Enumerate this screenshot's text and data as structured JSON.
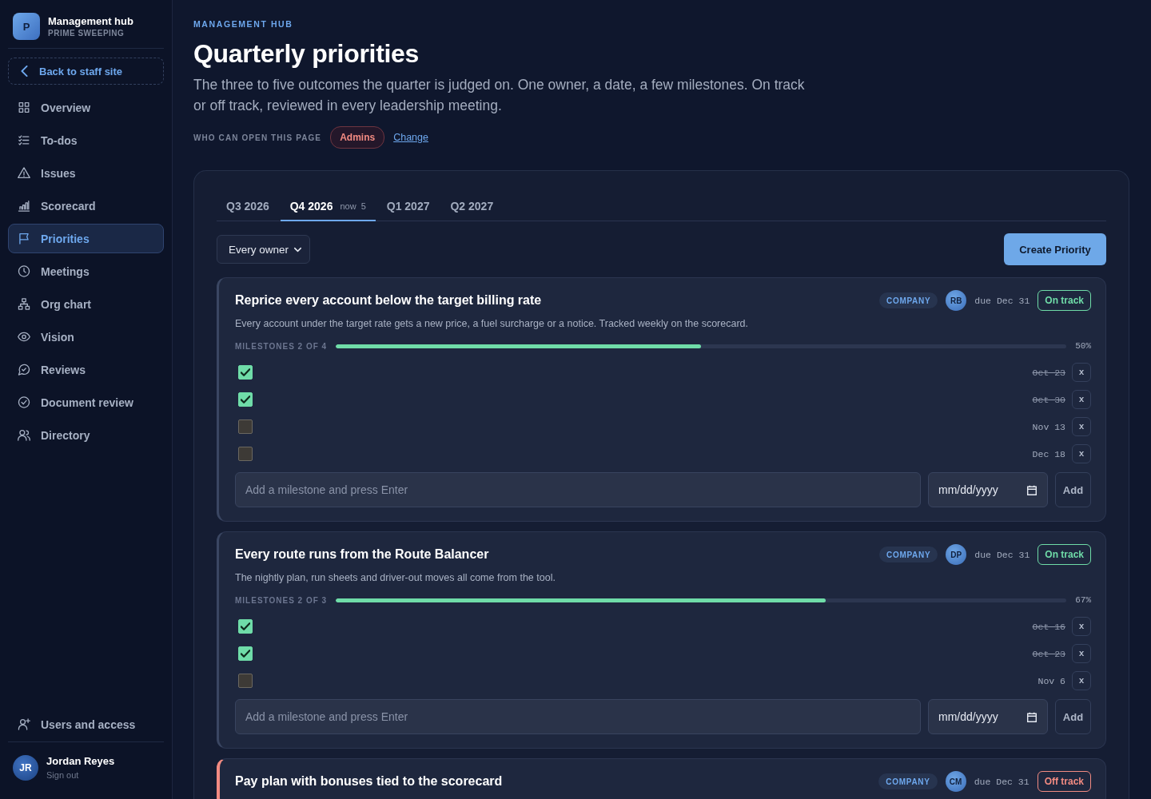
{
  "sidebar": {
    "brand": {
      "initial": "P",
      "title": "Management hub",
      "subtitle": "PRIME SWEEPING"
    },
    "back_link": "Back to staff site",
    "nav": [
      {
        "label": "Overview",
        "selected": false
      },
      {
        "label": "To-dos",
        "selected": false
      },
      {
        "label": "Issues",
        "selected": false
      },
      {
        "label": "Scorecard",
        "selected": false
      },
      {
        "label": "Priorities",
        "selected": true
      },
      {
        "label": "Meetings",
        "selected": false
      },
      {
        "label": "Org chart",
        "selected": false
      },
      {
        "label": "Vision",
        "selected": false
      },
      {
        "label": "Reviews",
        "selected": false
      },
      {
        "label": "Document review",
        "selected": false
      },
      {
        "label": "Directory",
        "selected": false
      }
    ],
    "footer_link": "Users and access",
    "user": {
      "initials": "JR",
      "name": "Jordan Reyes",
      "action": "Sign out"
    }
  },
  "header": {
    "eyebrow": "MANAGEMENT HUB",
    "title": "Quarterly priorities",
    "description": "The three to five outcomes the quarter is judged on. One owner, a date, a few milestones. On track or off track, reviewed in every leadership meeting.",
    "access": {
      "label": "WHO CAN OPEN THIS PAGE",
      "role": "Admins",
      "link": "Change"
    }
  },
  "tabs": [
    {
      "label": "Q3 2026",
      "selected": false
    },
    {
      "label": "Q4 2026",
      "note": "now",
      "count": "5",
      "selected": true
    },
    {
      "label": "Q1 2027",
      "selected": false
    },
    {
      "label": "Q2 2027",
      "selected": false
    }
  ],
  "filter": {
    "value": "Every owner"
  },
  "create_button": "Create Priority",
  "priorities": [
    {
      "title": "Reprice every account below the target billing rate",
      "scope": "COMPANY",
      "owner": "RB",
      "due": "due Dec 31",
      "status": {
        "label": "On track",
        "kind": "on_track"
      },
      "description": "Every account under the target rate gets a new price, a fuel surcharge or a notice. Tracked weekly on the scorecard.",
      "progress": {
        "label": "MILESTONES 2 OF 4",
        "level": 0.5,
        "percent": "50%"
      },
      "milestones": [
        {
          "checked": true,
          "date": "Oct 23",
          "remove": "x"
        },
        {
          "checked": true,
          "date": "Oct 30",
          "remove": "x"
        },
        {
          "checked": false,
          "date": "Nov 13",
          "remove": "x"
        },
        {
          "checked": false,
          "date": "Dec 18",
          "remove": "x"
        }
      ],
      "new_milestone": {
        "placeholder": "Add a milestone and press Enter",
        "date_placeholder": "mm/dd/yyyy",
        "add": "Add"
      }
    },
    {
      "title": "Every route runs from the Route Balancer",
      "scope": "COMPANY",
      "owner": "DP",
      "due": "due Dec 31",
      "status": {
        "label": "On track",
        "kind": "on_track"
      },
      "description": "The nightly plan, run sheets and driver-out moves all come from the tool.",
      "progress": {
        "label": "MILESTONES 2 OF 3",
        "level": 0.67,
        "percent": "67%"
      },
      "milestones": [
        {
          "checked": true,
          "date": "Oct 16",
          "remove": "x"
        },
        {
          "checked": true,
          "date": "Oct 23",
          "remove": "x"
        },
        {
          "checked": false,
          "date": "Nov 6",
          "remove": "x"
        }
      ],
      "new_milestone": {
        "placeholder": "Add a milestone and press Enter",
        "date_placeholder": "mm/dd/yyyy",
        "add": "Add"
      }
    },
    {
      "title": "Pay plan with bonuses tied to the scorecard",
      "scope": "COMPANY",
      "owner": "CM",
      "due": "due Dec 31",
      "status": {
        "label": "Off track",
        "kind": "off_track"
      }
    }
  ]
}
